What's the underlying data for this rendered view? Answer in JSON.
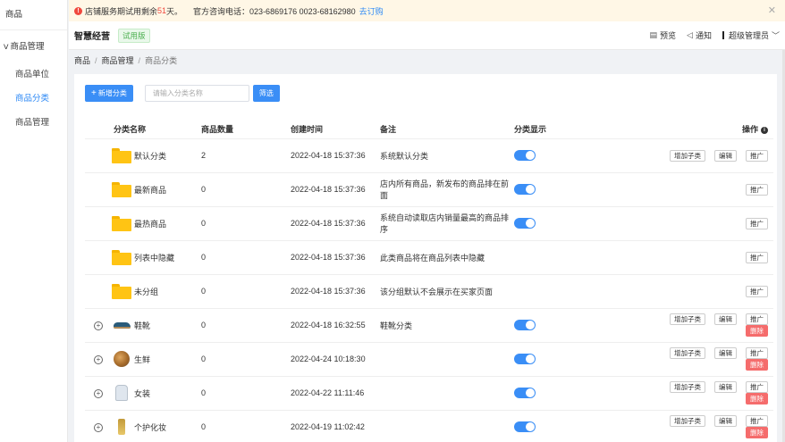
{
  "sidebar": {
    "title": "商品",
    "group": "商品管理",
    "items": [
      {
        "label": "商品单位",
        "active": false
      },
      {
        "label": "商品分类",
        "active": true
      },
      {
        "label": "商品管理",
        "active": false
      }
    ]
  },
  "notice": {
    "prefix": "店铺服务期试用剩余",
    "days": "51",
    "suffix": "天。",
    "contact": "官方咨询电话：023-6869176 0023-68162980",
    "link": "去订购"
  },
  "header": {
    "brand": "智慧经营",
    "badge": "试用版",
    "preview": "预览",
    "notify": "通知",
    "user": "超级管理员"
  },
  "breadcrumb": [
    "商品",
    "商品管理",
    "商品分类"
  ],
  "toolbar": {
    "add_label": "新增分类",
    "search_placeholder": "请输入分类名称",
    "filter_label": "筛选"
  },
  "table": {
    "headers": {
      "name": "分类名称",
      "qty": "商品数量",
      "time": "创建时间",
      "note": "备注",
      "show": "分类显示",
      "op": "操作"
    },
    "ops": {
      "add_sub": "增加子类",
      "edit": "编辑",
      "promote": "推广",
      "delete": "删除"
    },
    "rows": [
      {
        "expand": false,
        "icon": "folder",
        "name": "默认分类",
        "qty": "2",
        "time": "2022-04-18 15:37:36",
        "note": "系统默认分类",
        "show": true,
        "ops": [
          "add_sub",
          "edit",
          "promote"
        ]
      },
      {
        "expand": false,
        "icon": "folder",
        "name": "最新商品",
        "qty": "0",
        "time": "2022-04-18 15:37:36",
        "note": "店内所有商品，新发布的商品排在前面",
        "show": true,
        "ops": [
          "promote"
        ]
      },
      {
        "expand": false,
        "icon": "folder",
        "name": "最热商品",
        "qty": "0",
        "time": "2022-04-18 15:37:36",
        "note": "系统自动读取店内销量最高的商品排序",
        "show": true,
        "ops": [
          "promote"
        ]
      },
      {
        "expand": false,
        "icon": "folder",
        "name": "列表中隐藏",
        "qty": "0",
        "time": "2022-04-18 15:37:36",
        "note": "此类商品将在商品列表中隐藏",
        "show": false,
        "ops": [
          "promote"
        ]
      },
      {
        "expand": false,
        "icon": "folder",
        "name": "未分组",
        "qty": "0",
        "time": "2022-04-18 15:37:36",
        "note": "该分组默认不会展示在买家页面",
        "show": false,
        "ops": [
          "promote"
        ]
      },
      {
        "expand": true,
        "icon": "shoe",
        "name": "鞋靴",
        "qty": "0",
        "time": "2022-04-18 16:32:55",
        "note": "鞋靴分类",
        "show": true,
        "ops": [
          "add_sub",
          "edit",
          "promote",
          "delete"
        ]
      },
      {
        "expand": true,
        "icon": "food",
        "name": "生鲜",
        "qty": "0",
        "time": "2022-04-24 10:18:30",
        "note": "",
        "show": true,
        "ops": [
          "add_sub",
          "edit",
          "promote",
          "delete"
        ]
      },
      {
        "expand": true,
        "icon": "dress",
        "name": "女装",
        "qty": "0",
        "time": "2022-04-22 11:11:46",
        "note": "",
        "show": true,
        "ops": [
          "add_sub",
          "edit",
          "promote",
          "delete"
        ]
      },
      {
        "expand": true,
        "icon": "bottle",
        "name": "个护化妆",
        "qty": "0",
        "time": "2022-04-19 11:02:42",
        "note": "",
        "show": true,
        "ops": [
          "add_sub",
          "edit",
          "promote",
          "delete"
        ]
      }
    ]
  }
}
